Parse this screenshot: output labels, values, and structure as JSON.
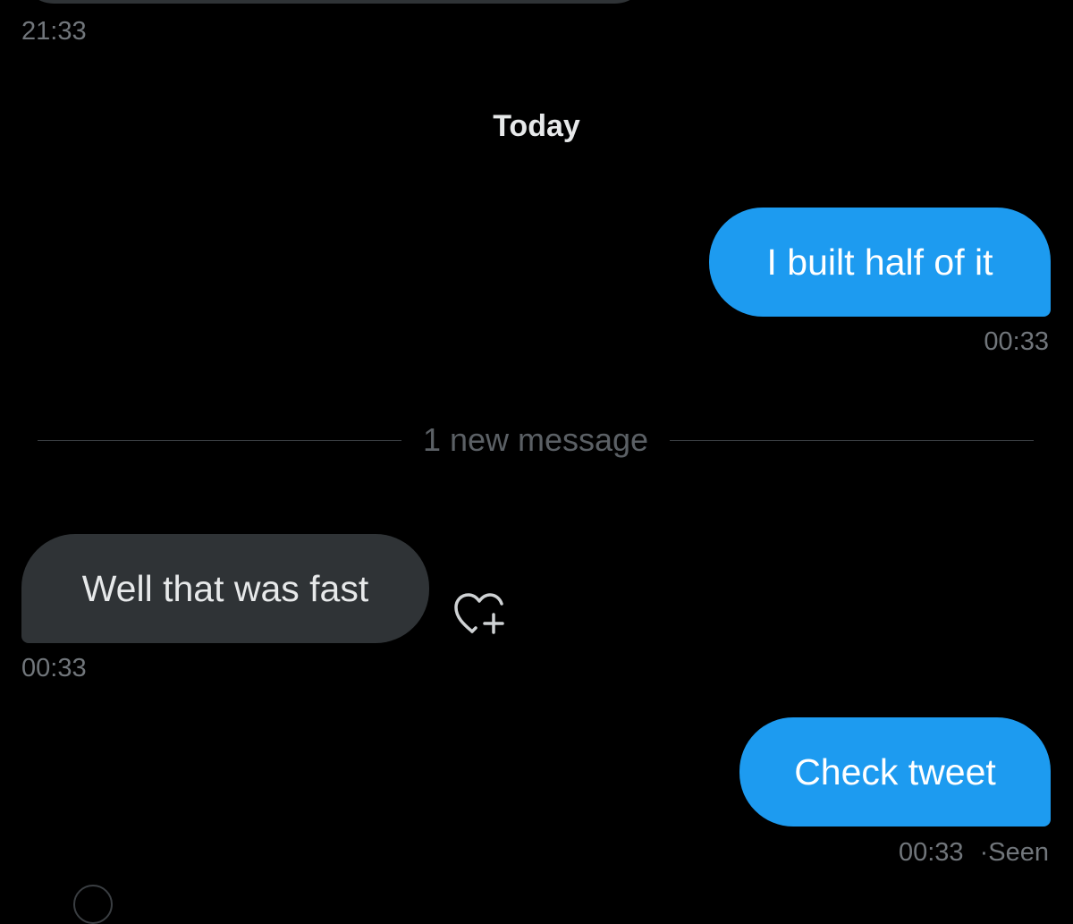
{
  "conversation": {
    "previous_message": {
      "time": "21:33"
    },
    "day_separator": "Today",
    "messages": [
      {
        "direction": "outgoing",
        "text": "I built half of it",
        "time": "00:33"
      },
      {
        "direction": "incoming",
        "text": "Well that was fast",
        "time": "00:33",
        "reaction_icon": "add-reaction-heart-icon"
      },
      {
        "direction": "outgoing",
        "text": "Check tweet",
        "time": "00:33",
        "status_separator": "·",
        "status": "Seen"
      }
    ],
    "new_messages_divider": "1 new message"
  },
  "colors": {
    "background": "#000000",
    "outgoing_bubble": "#1d9bf0",
    "incoming_bubble": "#2f3336",
    "timestamp": "#71767b",
    "text_primary": "#e7e9ea"
  }
}
